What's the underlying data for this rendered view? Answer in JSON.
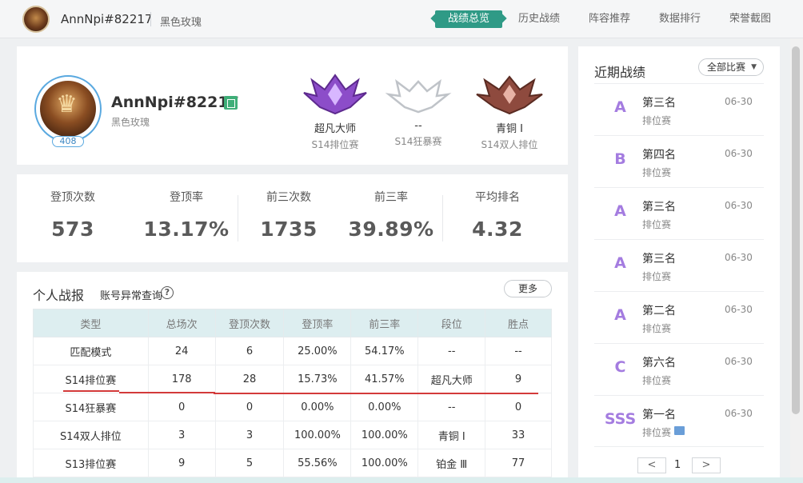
{
  "header": {
    "username": "AnnNpi#82217",
    "subtitle": "黑色玫瑰",
    "nav": [
      "战绩总览",
      "历史战绩",
      "阵容推荐",
      "数据排行",
      "荣誉截图"
    ]
  },
  "profile": {
    "name": "AnnNpi#82217",
    "server": "黑色玫瑰",
    "level": "408",
    "ranks": [
      {
        "name": "超凡大师",
        "season": "S14排位赛"
      },
      {
        "name": "--",
        "season": "S14狂暴赛"
      },
      {
        "name": "青铜 Ⅰ",
        "season": "S14双人排位"
      }
    ]
  },
  "stats": [
    {
      "label": "登顶次数",
      "value": "573"
    },
    {
      "label": "登顶率",
      "value": "13.17%"
    },
    {
      "label": "前三次数",
      "value": "1735"
    },
    {
      "label": "前三率",
      "value": "39.89%"
    },
    {
      "label": "平均排名",
      "value": "4.32"
    }
  ],
  "report": {
    "title": "个人战报",
    "query_link": "账号异常查询",
    "more": "更多",
    "headers": [
      "类型",
      "总场次",
      "登顶次数",
      "登顶率",
      "前三率",
      "段位",
      "胜点"
    ],
    "rows": [
      [
        "匹配模式",
        "24",
        "6",
        "25.00%",
        "54.17%",
        "--",
        "--"
      ],
      [
        "S14排位赛",
        "178",
        "28",
        "15.73%",
        "41.57%",
        "超凡大师",
        "9"
      ],
      [
        "S14狂暴赛",
        "0",
        "0",
        "0.00%",
        "0.00%",
        "--",
        "0"
      ],
      [
        "S14双人排位",
        "3",
        "3",
        "100.00%",
        "100.00%",
        "青铜 Ⅰ",
        "33"
      ],
      [
        "S13排位赛",
        "9",
        "5",
        "55.56%",
        "100.00%",
        "铂金 Ⅲ",
        "77"
      ]
    ]
  },
  "recent": {
    "title": "近期战绩",
    "filter": "全部比赛",
    "matches": [
      {
        "grade": "A",
        "place": "第三名",
        "mode": "排位赛",
        "date": "06-30"
      },
      {
        "grade": "B",
        "place": "第四名",
        "mode": "排位赛",
        "date": "06-30"
      },
      {
        "grade": "A",
        "place": "第三名",
        "mode": "排位赛",
        "date": "06-30"
      },
      {
        "grade": "A",
        "place": "第三名",
        "mode": "排位赛",
        "date": "06-30"
      },
      {
        "grade": "A",
        "place": "第二名",
        "mode": "排位赛",
        "date": "06-30"
      },
      {
        "grade": "C",
        "place": "第六名",
        "mode": "排位赛",
        "date": "06-30"
      },
      {
        "grade": "SSS",
        "place": "第一名",
        "mode": "排位赛",
        "date": "06-30"
      }
    ],
    "page": "1"
  },
  "colors": {
    "accent": "#2f9a86",
    "grade": "#a47ce0"
  }
}
